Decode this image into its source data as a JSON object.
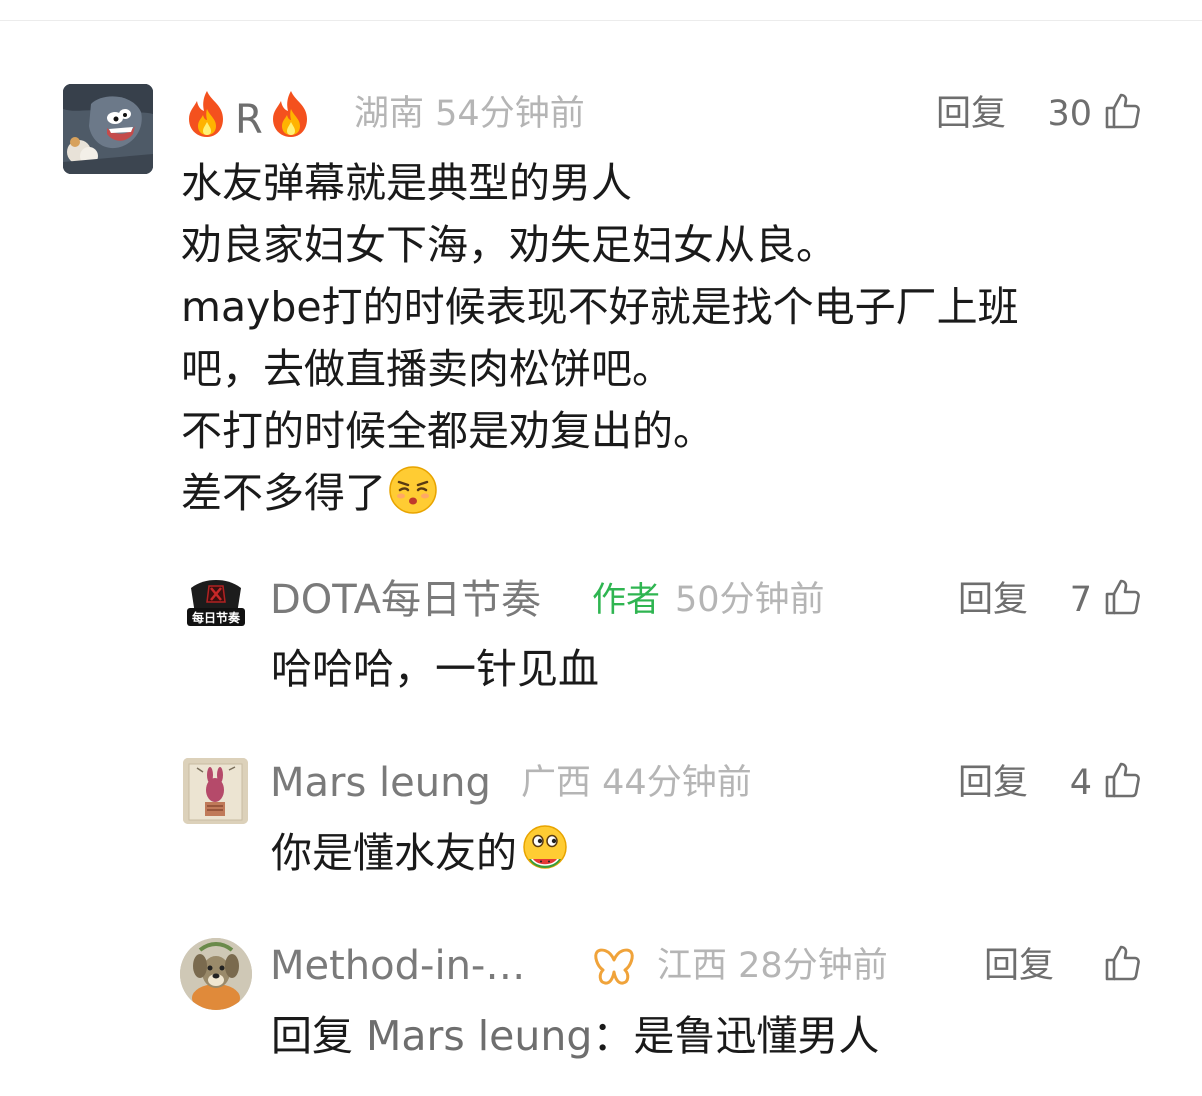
{
  "main_comment": {
    "username": "R",
    "location": "湖南",
    "time": "54分钟前",
    "reply_label": "回复",
    "likes": "30",
    "lines": [
      "水友弹幕就是典型的男人",
      "劝良家妇女下海，劝失足妇女从良。",
      "maybe打的时候表现不好就是找个电子厂上班",
      "吧，去做直播卖肉松饼吧。",
      "不打的时候全都是劝复出的。",
      "差不多得了"
    ],
    "end_emoji": "hmph-emoji"
  },
  "replies": [
    {
      "username": "DOTA每日节奏",
      "tag": "作者",
      "time": "50分钟前",
      "reply_label": "回复",
      "likes": "7",
      "content": "哈哈哈，一针见血",
      "avatar_text": "每日节奏"
    },
    {
      "username": "Mars leung",
      "location": "广西",
      "time": "44分钟前",
      "reply_label": "回复",
      "likes": "4",
      "content": "你是懂水友的",
      "end_emoji": "eating-melon-emoji"
    },
    {
      "username": "Method-in-…",
      "location": "江西",
      "time": "28分钟前",
      "reply_label": "回复",
      "likes": "",
      "content_prefix": "回复",
      "reply_target": "Mars leung",
      "content_suffix": "：是鲁迅懂男人"
    }
  ],
  "colors": {
    "username": "#7a7a7a",
    "meta": "#b5b5b5",
    "author_tag": "#2fb551",
    "content": "#1a1a1a",
    "badge": "#f0a33a"
  }
}
